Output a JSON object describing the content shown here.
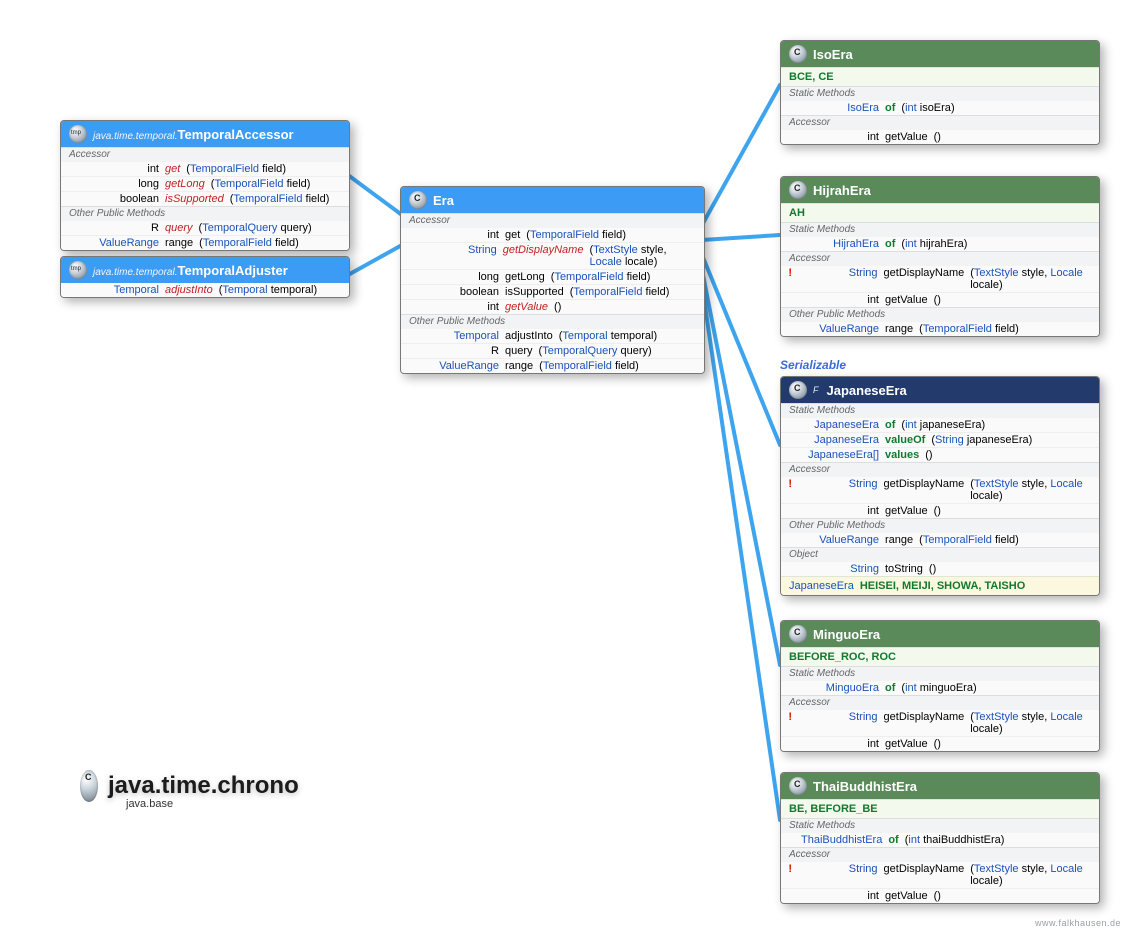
{
  "package": {
    "name": "java.time.chrono",
    "module": "java.base"
  },
  "serializable_label": "Serializable",
  "footer": "www.falkhausen.de",
  "boxes": {
    "temporalAccessor": {
      "pkg": "java.time.temporal.",
      "name": "TemporalAccessor",
      "sections": [
        {
          "title": "Accessor",
          "rows": [
            {
              "ret": "int",
              "retType": false,
              "method": "get",
              "mstyle": "red",
              "params": "(TemporalField field)"
            },
            {
              "ret": "long",
              "retType": false,
              "method": "getLong",
              "mstyle": "red",
              "params": "(TemporalField field)"
            },
            {
              "ret": "boolean",
              "retType": false,
              "method": "isSupported",
              "mstyle": "red",
              "params": "(TemporalField field)"
            }
          ]
        },
        {
          "title": "Other Public Methods",
          "rows": [
            {
              "ret": "<R> R",
              "retType": false,
              "method": "query",
              "mstyle": "red",
              "params": "(TemporalQuery<R> query)"
            },
            {
              "ret": "ValueRange",
              "retType": true,
              "method": "range",
              "params": "(TemporalField field)"
            }
          ]
        }
      ]
    },
    "temporalAdjuster": {
      "pkg": "java.time.temporal.",
      "name": "TemporalAdjuster",
      "rows": [
        {
          "ret": "Temporal",
          "retType": true,
          "method": "adjustInto",
          "mstyle": "red",
          "params": "(Temporal temporal)"
        }
      ]
    },
    "era": {
      "name": "Era",
      "sections": [
        {
          "title": "Accessor",
          "rows": [
            {
              "ret": "int",
              "method": "get",
              "params": "(TemporalField field)"
            },
            {
              "ret": "String",
              "retType": true,
              "method": "getDisplayName",
              "mstyle": "red",
              "params": "(TextStyle style, Locale locale)"
            },
            {
              "ret": "long",
              "method": "getLong",
              "params": "(TemporalField field)"
            },
            {
              "ret": "boolean",
              "method": "isSupported",
              "params": "(TemporalField field)"
            },
            {
              "ret": "int",
              "method": "getValue",
              "mstyle": "red",
              "params": "()"
            }
          ]
        },
        {
          "title": "Other Public Methods",
          "rows": [
            {
              "ret": "Temporal",
              "retType": true,
              "method": "adjustInto",
              "params": "(Temporal temporal)"
            },
            {
              "ret": "<R> R",
              "method": "query",
              "params": "(TemporalQuery<R> query)"
            },
            {
              "ret": "ValueRange",
              "retType": true,
              "method": "range",
              "params": "(TemporalField field)"
            }
          ]
        }
      ]
    },
    "isoEra": {
      "name": "IsoEra",
      "consts": "BCE, CE",
      "sections": [
        {
          "title": "Static Methods",
          "rows": [
            {
              "ret": "IsoEra",
              "retType": true,
              "method": "of",
              "mstyle": "greenb",
              "params": "(int isoEra)"
            }
          ]
        },
        {
          "title": "Accessor",
          "rows": [
            {
              "ret": "int",
              "method": "getValue",
              "params": "()"
            }
          ]
        }
      ]
    },
    "hijrahEra": {
      "name": "HijrahEra",
      "consts": "AH",
      "sections": [
        {
          "title": "Static Methods",
          "rows": [
            {
              "ret": "HijrahEra",
              "retType": true,
              "method": "of",
              "mstyle": "greenb",
              "params": "(int hijrahEra)"
            }
          ]
        },
        {
          "title": "Accessor",
          "rows": [
            {
              "bang": true,
              "ret": "String",
              "retType": true,
              "method": "getDisplayName",
              "params": "(TextStyle style, Locale locale)"
            },
            {
              "ret": "int",
              "method": "getValue",
              "params": "()"
            }
          ]
        },
        {
          "title": "Other Public Methods",
          "rows": [
            {
              "ret": "ValueRange",
              "retType": true,
              "method": "range",
              "params": "(TemporalField field)"
            }
          ]
        }
      ]
    },
    "japaneseEra": {
      "name": "JapaneseEra",
      "final": true,
      "sections": [
        {
          "title": "Static Methods",
          "rows": [
            {
              "ret": "JapaneseEra",
              "retType": true,
              "method": "of",
              "mstyle": "greenb",
              "params": "(int japaneseEra)"
            },
            {
              "ret": "JapaneseEra",
              "retType": true,
              "method": "valueOf",
              "mstyle": "greenb",
              "params": "(String japaneseEra)"
            },
            {
              "ret": "JapaneseEra[]",
              "retType": true,
              "method": "values",
              "mstyle": "greenb",
              "params": "()"
            }
          ]
        },
        {
          "title": "Accessor",
          "rows": [
            {
              "bang": true,
              "ret": "String",
              "retType": true,
              "method": "getDisplayName",
              "params": "(TextStyle style, Locale locale)"
            },
            {
              "ret": "int",
              "method": "getValue",
              "params": "()"
            }
          ]
        },
        {
          "title": "Other Public Methods",
          "rows": [
            {
              "ret": "ValueRange",
              "retType": true,
              "method": "range",
              "params": "(TemporalField field)"
            }
          ]
        },
        {
          "title": "Object",
          "rows": [
            {
              "ret": "String",
              "retType": true,
              "method": "toString",
              "params": "()"
            }
          ]
        }
      ],
      "constsRow": {
        "rt": "JapaneseEra",
        "text": "HEISEI, MEIJI, SHOWA, TAISHO"
      }
    },
    "minguoEra": {
      "name": "MinguoEra",
      "consts": "BEFORE_ROC, ROC",
      "sections": [
        {
          "title": "Static Methods",
          "rows": [
            {
              "ret": "MinguoEra",
              "retType": true,
              "method": "of",
              "mstyle": "greenb",
              "params": "(int minguoEra)"
            }
          ]
        },
        {
          "title": "Accessor",
          "rows": [
            {
              "bang": true,
              "ret": "String",
              "retType": true,
              "method": "getDisplayName",
              "params": "(TextStyle style, Locale locale)"
            },
            {
              "ret": "int",
              "method": "getValue",
              "params": "()"
            }
          ]
        }
      ]
    },
    "thaiEra": {
      "name": "ThaiBuddhistEra",
      "consts": "BE, BEFORE_BE",
      "sections": [
        {
          "title": "Static Methods",
          "rows": [
            {
              "ret": "ThaiBuddhistEra",
              "retType": true,
              "method": "of",
              "mstyle": "greenb",
              "params": "(int thaiBuddhistEra)"
            }
          ]
        },
        {
          "title": "Accessor",
          "rows": [
            {
              "bang": true,
              "ret": "String",
              "retType": true,
              "method": "getDisplayName",
              "params": "(TextStyle style, Locale locale)"
            },
            {
              "ret": "int",
              "method": "getValue",
              "params": "()"
            }
          ]
        }
      ]
    }
  }
}
